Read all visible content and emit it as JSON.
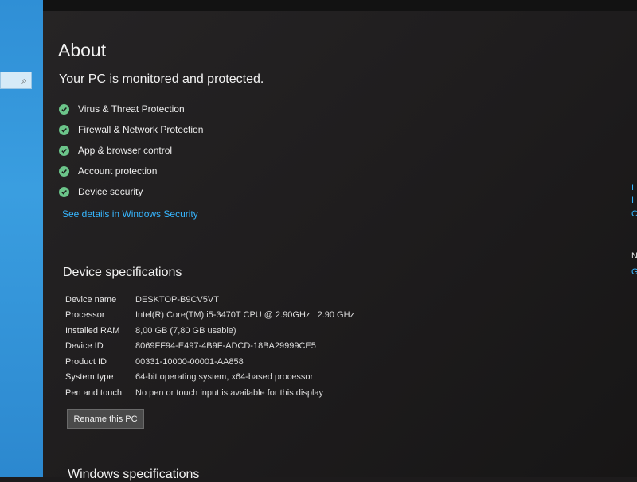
{
  "sidebar": {
    "search_icon": "magnifier-icon"
  },
  "header": {
    "title": "About"
  },
  "security": {
    "status": "Your PC is monitored and protected.",
    "items": [
      {
        "label": "Virus & Threat Protection",
        "icon": "check-circle-icon"
      },
      {
        "label": "Firewall & Network Protection",
        "icon": "check-circle-icon"
      },
      {
        "label": "App & browser control",
        "icon": "check-circle-icon"
      },
      {
        "label": "Account protection",
        "icon": "check-circle-icon"
      },
      {
        "label": "Device security",
        "icon": "check-circle-icon"
      }
    ],
    "details_link": "See details in Windows Security"
  },
  "device_specs": {
    "heading": "Device specifications",
    "rows": [
      {
        "key": "Device name",
        "value": "DESKTOP-B9CV5VT"
      },
      {
        "key": "Processor",
        "value": "Intel(R) Core(TM) i5-3470T CPU @ 2.90GHz   2.90 GHz"
      },
      {
        "key": "Installed RAM",
        "value": "8,00 GB (7,80 GB usable)"
      },
      {
        "key": "Device ID",
        "value": "8069FF94-E497-4B9F-ADCD-18BA29999CE5"
      },
      {
        "key": "Product ID",
        "value": "00331-10000-00001-AA858"
      },
      {
        "key": "System type",
        "value": "64-bit operating system, x64-based processor"
      },
      {
        "key": "Pen and touch",
        "value": "No pen or touch input is available for this display"
      }
    ],
    "rename_button": "Rename this PC"
  },
  "windows_specs": {
    "heading": "Windows specifications"
  },
  "right_partial": {
    "glyphs": [
      "I",
      "I",
      "C",
      "N",
      "G"
    ]
  },
  "colors": {
    "link": "#37b6ff",
    "check": "#6cc58a",
    "sidebar_blue": "#2f8fd6"
  }
}
